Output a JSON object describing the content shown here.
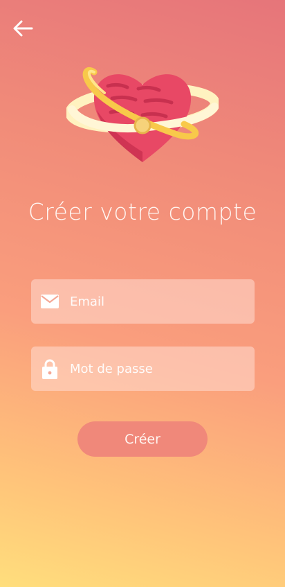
{
  "header": {
    "back_icon": "arrow-left-icon"
  },
  "logo": {
    "icon": "heart-with-ring-icon",
    "colors": {
      "heart": "#e84865",
      "heart_dark": "#c8304f",
      "ring": "#ffe9a6",
      "ring_gold": "#f8c94a"
    }
  },
  "title": "Créer votre compte",
  "form": {
    "email": {
      "icon": "envelope-icon",
      "placeholder": "Email",
      "value": ""
    },
    "password": {
      "icon": "lock-icon",
      "placeholder": "Mot de passe",
      "value": ""
    },
    "submit_label": "Créer"
  },
  "colors": {
    "gradient_top": "#e6757a",
    "gradient_mid": "#fa9e7d",
    "gradient_bottom": "#ffde7c",
    "button": "#f0887a",
    "field_background": "#ffdcd2"
  }
}
